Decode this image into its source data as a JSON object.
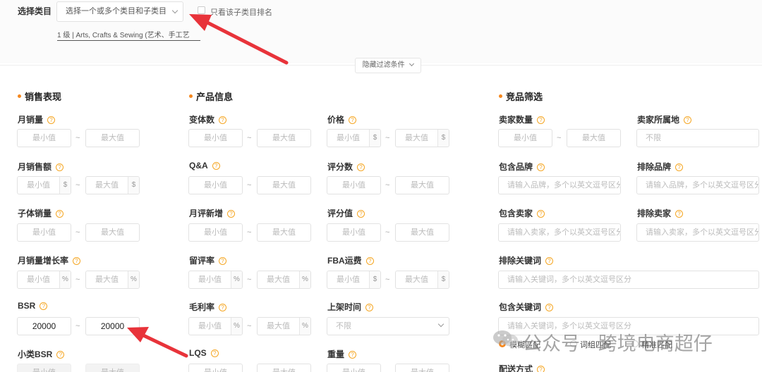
{
  "top": {
    "category_label": "选择类目",
    "category_placeholder": "选择一个或多个类目和子类目",
    "subcat_only_label": "只看该子类目排名",
    "breadcrumb": "1 级 | Arts, Crafts & Sewing (艺术、手工艺",
    "hide_filters": "隐藏过滤条件"
  },
  "sections": {
    "sales": "销售表现",
    "product": "产品信息",
    "competitor": "竞品筛选"
  },
  "common": {
    "min": "最小值",
    "max": "最大值",
    "tilde": "~",
    "dollar": "$",
    "percent": "%",
    "unlimited": "不限",
    "q": "?"
  },
  "sales": {
    "monthly_sales": "月销量",
    "monthly_revenue": "月销售额",
    "child_sales": "子体销量",
    "sales_growth": "月销量增长率",
    "bsr": "BSR",
    "bsr_min": "20000",
    "bsr_max": "20000",
    "sub_bsr": "小类BSR"
  },
  "product": {
    "variants": "变体数",
    "price": "价格",
    "qa": "Q&A",
    "reviews": "评分数",
    "monthly_new_reviews": "月评新增",
    "rating": "评分值",
    "review_rate": "留评率",
    "fba_fee": "FBA运费",
    "gross_margin": "毛利率",
    "listing_time": "上架时间",
    "lqs": "LQS",
    "weight": "重量"
  },
  "competitor": {
    "seller_count": "卖家数量",
    "seller_location": "卖家所属地",
    "include_brand": "包含品牌",
    "exclude_brand": "排除品牌",
    "brand_placeholder": "请输入品牌，多个以英文逗号区分",
    "include_seller": "包含卖家",
    "exclude_seller": "排除卖家",
    "seller_placeholder": "请输入卖家，多个以英文逗号区分",
    "exclude_keywords": "排除关键词",
    "include_keywords": "包含关键词",
    "keyword_placeholder": "请输入关键词，多个以英文逗号区分",
    "fuzzy_match": "模糊匹配",
    "phrase_match": "词组匹配",
    "exact_match": "精准匹配",
    "delivery": "配送方式"
  },
  "watermark": "公众号 · 跨境电商超仔",
  "colors": {
    "accent": "#f5881f",
    "arrow": "#e8333a"
  }
}
